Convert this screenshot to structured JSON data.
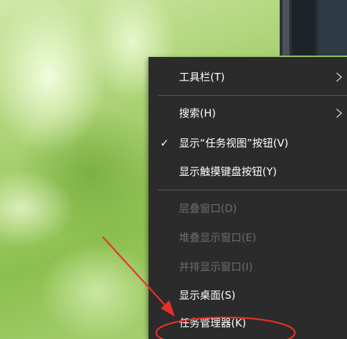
{
  "context_menu": {
    "items": [
      {
        "label": "工具栏(T)",
        "enabled": true,
        "submenu": true
      },
      {
        "label": "搜索(H)",
        "enabled": true,
        "submenu": true
      },
      {
        "label": "显示“任务视图”按钮(V)",
        "enabled": true,
        "checked": true
      },
      {
        "label": "显示触摸键盘按钮(Y)",
        "enabled": true
      },
      {
        "label": "层叠窗口(D)",
        "enabled": false
      },
      {
        "label": "堆叠显示窗口(E)",
        "enabled": false
      },
      {
        "label": "并排显示窗口(I)",
        "enabled": false
      },
      {
        "label": "显示桌面(S)",
        "enabled": true
      },
      {
        "label": "任务管理器(K)",
        "enabled": true,
        "highlighted": true
      }
    ],
    "check_glyph": "✓",
    "colors": {
      "background": "#2b2b2b",
      "text": "#ffffff",
      "disabled_text": "#6d6d6d",
      "annotation": "#e8302a"
    }
  }
}
